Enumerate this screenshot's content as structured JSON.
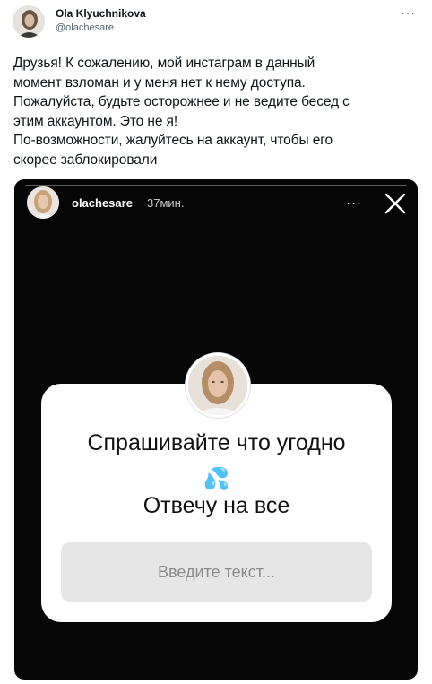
{
  "tweet": {
    "author_name": "Ola Klyuchnikova",
    "author_handle": "@olachesare",
    "more_label": "···",
    "text": "Друзья! К сожалению, мой инстаграм в данный\nмомент взломан и у меня нет к нему доступа.\nПожалуйста, будьте осторожнее и не ведите бесед с\nэтим аккаунтом. Это не я!\nПо-возможности, жалуйтесь на аккаунт, чтобы его\nскорее заблокировали"
  },
  "story": {
    "username": "olachesare",
    "time": "37мин.",
    "more_label": "···",
    "progress": 0.0,
    "question_line1": "Спрашивайте что угодно",
    "emoji": "💦",
    "question_line2": "Отвечу на все",
    "input_placeholder": "Введите текст..."
  },
  "colors": {
    "story_bg": "#060606",
    "card_bg": "#ffffff",
    "input_bg": "#e6e6e6",
    "handle": "#536471"
  }
}
